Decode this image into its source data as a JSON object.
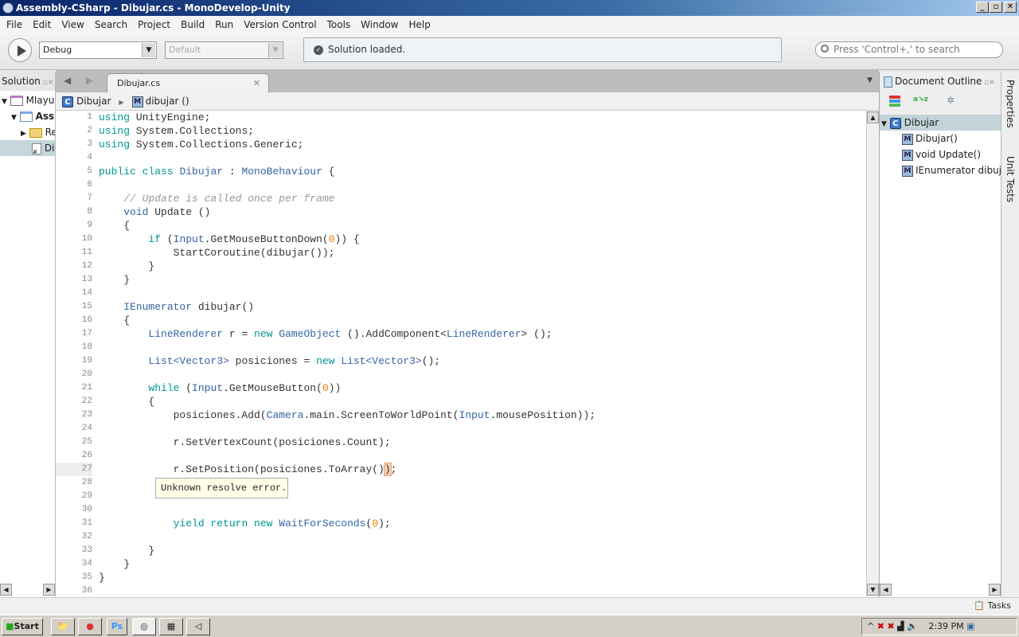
{
  "window": {
    "title": "Assembly-CSharp - Dibujar.cs - MonoDevelop-Unity",
    "controls": [
      "_",
      "▫",
      "✕"
    ]
  },
  "menu": [
    "File",
    "Edit",
    "View",
    "Search",
    "Project",
    "Build",
    "Run",
    "Version Control",
    "Tools",
    "Window",
    "Help"
  ],
  "toolbar": {
    "config": "Debug",
    "target": "Default",
    "status": "Solution loaded.",
    "search_placeholder": "Press 'Control+,' to search"
  },
  "solution": {
    "title": "Solution",
    "items": [
      "Mlayu",
      "Ass",
      "Re",
      "Di"
    ]
  },
  "editor": {
    "tab": "Dibujar.cs",
    "breadcrumb": [
      "Dibujar",
      "dibujar ()"
    ],
    "tooltip": "Unknown resolve error.",
    "current_line": 27,
    "lines": [
      [
        [
          "k",
          "using"
        ],
        [
          "p",
          " UnityEngine;"
        ]
      ],
      [
        [
          "k",
          "using"
        ],
        [
          "p",
          " System.Collections;"
        ]
      ],
      [
        [
          "k",
          "using"
        ],
        [
          "p",
          " System.Collections.Generic;"
        ]
      ],
      [],
      [
        [
          "k",
          "public class"
        ],
        [
          "p",
          " "
        ],
        [
          "t",
          "Dibujar"
        ],
        [
          "p",
          " : "
        ],
        [
          "t",
          "MonoBehaviour"
        ],
        [
          "p",
          " {"
        ]
      ],
      [],
      [
        [
          "p",
          "    "
        ],
        [
          "c",
          "// Update is called once per frame"
        ]
      ],
      [
        [
          "p",
          "    "
        ],
        [
          "t",
          "void"
        ],
        [
          "p",
          " Update ()"
        ]
      ],
      [
        [
          "p",
          "    {"
        ]
      ],
      [
        [
          "p",
          "        "
        ],
        [
          "k",
          "if"
        ],
        [
          "p",
          " ("
        ],
        [
          "t",
          "Input"
        ],
        [
          "p",
          ".GetMouseButtonDown("
        ],
        [
          "n",
          "0"
        ],
        [
          "p",
          ")) {"
        ]
      ],
      [
        [
          "p",
          "            StartCoroutine(dibujar());"
        ]
      ],
      [
        [
          "p",
          "        }"
        ]
      ],
      [
        [
          "p",
          "    }"
        ]
      ],
      [],
      [
        [
          "p",
          "    "
        ],
        [
          "t",
          "IEnumerator"
        ],
        [
          "p",
          " dibujar()"
        ]
      ],
      [
        [
          "p",
          "    {"
        ]
      ],
      [
        [
          "p",
          "        "
        ],
        [
          "t",
          "LineRenderer"
        ],
        [
          "p",
          " r = "
        ],
        [
          "k",
          "new"
        ],
        [
          "p",
          " "
        ],
        [
          "t",
          "GameObject"
        ],
        [
          "p",
          " ().AddComponent<"
        ],
        [
          "t",
          "LineRenderer"
        ],
        [
          "p",
          "> ();"
        ]
      ],
      [],
      [
        [
          "p",
          "        "
        ],
        [
          "t",
          "List<Vector3>"
        ],
        [
          "p",
          " posiciones = "
        ],
        [
          "k",
          "new"
        ],
        [
          "p",
          " "
        ],
        [
          "t",
          "List<Vector3>"
        ],
        [
          "p",
          "();"
        ]
      ],
      [],
      [
        [
          "p",
          "        "
        ],
        [
          "k",
          "while"
        ],
        [
          "p",
          " ("
        ],
        [
          "t",
          "Input"
        ],
        [
          "p",
          ".GetMouseButton("
        ],
        [
          "n",
          "0"
        ],
        [
          "p",
          "))"
        ]
      ],
      [
        [
          "p",
          "        {"
        ]
      ],
      [
        [
          "p",
          "            posiciones.Add("
        ],
        [
          "t",
          "Camera"
        ],
        [
          "p",
          ".main.ScreenToWorldPoint("
        ],
        [
          "t",
          "Input"
        ],
        [
          "p",
          ".mousePosition));"
        ]
      ],
      [],
      [
        [
          "p",
          "            r.SetVertexCount(posiciones.Count);"
        ]
      ],
      [],
      [
        [
          "p",
          "            r.SetPosition(posiciones.ToArray()"
        ],
        [
          "hl",
          ")"
        ],
        [
          "p",
          ";"
        ]
      ],
      [],
      [],
      [],
      [
        [
          "p",
          "            "
        ],
        [
          "k",
          "yield return new"
        ],
        [
          "p",
          " "
        ],
        [
          "t",
          "WaitForSeconds"
        ],
        [
          "p",
          "("
        ],
        [
          "n",
          "0"
        ],
        [
          "p",
          ");"
        ]
      ],
      [],
      [
        [
          "p",
          "        }"
        ]
      ],
      [
        [
          "p",
          "    }"
        ]
      ],
      [
        [
          "p",
          "}"
        ]
      ],
      []
    ]
  },
  "outline": {
    "title": "Document Outline",
    "root": "Dibujar",
    "items": [
      "Dibujar()",
      "void Update()",
      "IEnumerator dibujar()"
    ]
  },
  "side_tabs": [
    "Properties",
    "Unit Tests"
  ],
  "statusbar": {
    "tasks": "Tasks"
  },
  "taskbar": {
    "start": "Start",
    "clock": "2:39 PM"
  },
  "colors": {
    "keyword": "#009695",
    "type": "#3465a4",
    "comment": "#999999",
    "number": "#f57900"
  }
}
